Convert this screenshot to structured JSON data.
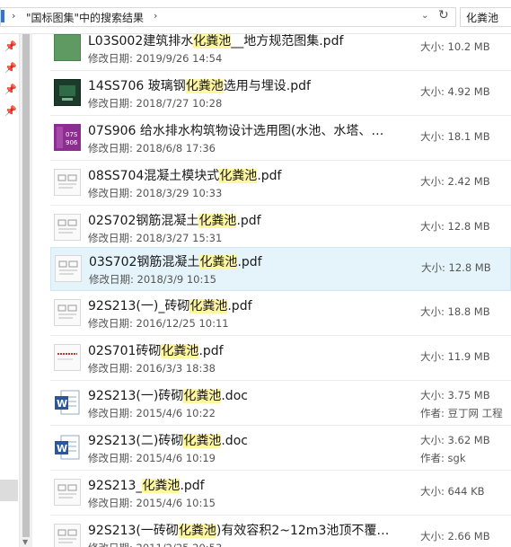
{
  "address": {
    "path_sep": "›",
    "breadcrumb": "\"国标图集\"中的搜索结果",
    "search_value": "化粪池"
  },
  "results": [
    {
      "name_pre": "L03S002建筑排水",
      "name_hl": "化粪池",
      "name_post": "__地方规范图集.pdf",
      "modified_label": "修改日期:",
      "modified": "2019/9/26 14:54",
      "size_label": "大小:",
      "size": "10.2 MB",
      "icon": "pdf-thumb-green"
    },
    {
      "name_pre": "14SS706  玻璃钢",
      "name_hl": "化粪池",
      "name_post": "选用与埋设.pdf",
      "modified_label": "修改日期:",
      "modified": "2018/7/27 10:28",
      "size_label": "大小:",
      "size": "4.92 MB",
      "icon": "pdf-thumb-dark"
    },
    {
      "name_pre": "07S906 给水排水构筑物设计选用图(水池、水塔、…",
      "name_hl": "",
      "name_post": "",
      "modified_label": "修改日期:",
      "modified": "2018/6/8 17:36",
      "size_label": "大小:",
      "size": "18.1 MB",
      "icon": "pdf-thumb-purple"
    },
    {
      "name_pre": "08SS704混凝土模块式",
      "name_hl": "化粪池",
      "name_post": ".pdf",
      "modified_label": "修改日期:",
      "modified": "2018/3/29 10:33",
      "size_label": "大小:",
      "size": "2.42 MB",
      "icon": "pdf-thumb-sheet"
    },
    {
      "name_pre": "02S702钢筋混凝土",
      "name_hl": "化粪池",
      "name_post": ".pdf",
      "modified_label": "修改日期:",
      "modified": "2018/3/27 15:31",
      "size_label": "大小:",
      "size": "12.8 MB",
      "icon": "pdf-thumb-sheet"
    },
    {
      "name_pre": "03S702钢筋混凝土",
      "name_hl": "化粪池",
      "name_post": ".pdf",
      "modified_label": "修改日期:",
      "modified": "2018/3/9 10:15",
      "size_label": "大小:",
      "size": "12.8 MB",
      "icon": "pdf-thumb-sheet",
      "selected": true
    },
    {
      "name_pre": "92S213(一)_砖砌",
      "name_hl": "化粪池",
      "name_post": ".pdf",
      "modified_label": "修改日期:",
      "modified": "2016/12/25 10:11",
      "size_label": "大小:",
      "size": "18.8 MB",
      "icon": "pdf-thumb-sheet"
    },
    {
      "name_pre": "02S701砖砌",
      "name_hl": "化粪池",
      "name_post": ".pdf",
      "modified_label": "修改日期:",
      "modified": "2016/3/3 18:38",
      "size_label": "大小:",
      "size": "11.9 MB",
      "icon": "pdf-thumb-red"
    },
    {
      "name_pre": "92S213(一)砖砌",
      "name_hl": "化粪池",
      "name_post": ".doc",
      "modified_label": "修改日期:",
      "modified": "2015/4/6 10:22",
      "size_label": "大小:",
      "size": "3.75 MB",
      "author_label": "作者:",
      "author": "豆丁网  工程",
      "icon": "word-doc"
    },
    {
      "name_pre": "92S213(二)砖砌",
      "name_hl": "化粪池",
      "name_post": ".doc",
      "modified_label": "修改日期:",
      "modified": "2015/4/6 10:19",
      "size_label": "大小:",
      "size": "3.62 MB",
      "author_label": "作者:",
      "author": "sgk",
      "icon": "word-doc"
    },
    {
      "name_pre": "92S213_",
      "name_hl": "化粪池",
      "name_post": ".pdf",
      "modified_label": "修改日期:",
      "modified": "2015/4/6 10:15",
      "size_label": "大小:",
      "size": "644 KB",
      "icon": "pdf-thumb-sheet"
    },
    {
      "name_pre": "92S213(一砖砌",
      "name_hl": "化粪池",
      "name_post": ")有效容积2~12m3池顶不覆…",
      "modified_label": "修改日期:",
      "modified": "2011/2/25 20:53",
      "size_label": "大小:",
      "size": "2.66 MB",
      "icon": "pdf-thumb-sheet"
    }
  ],
  "icons": {
    "pin": "pin-icon",
    "refresh": "refresh-icon",
    "dropdown": "chevron-down-icon"
  }
}
